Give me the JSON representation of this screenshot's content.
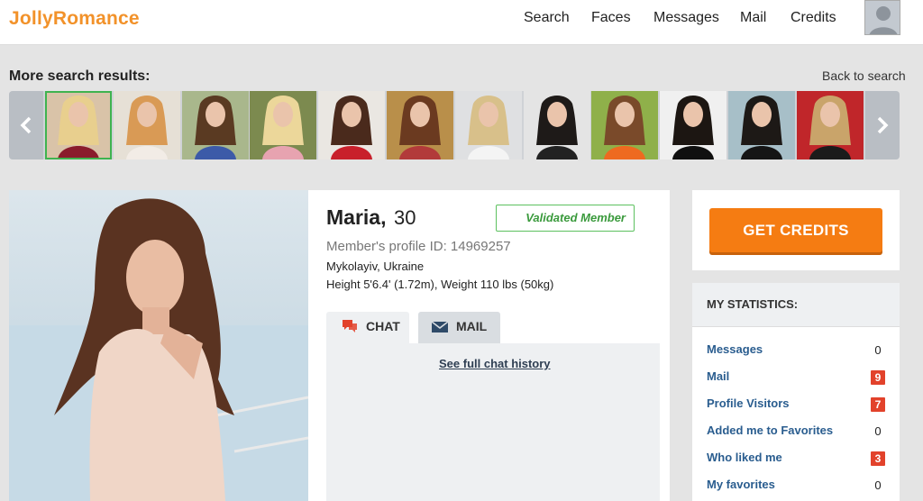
{
  "header": {
    "logo": "JollyRomance",
    "nav": [
      "Search",
      "Faces",
      "Messages",
      "Mail",
      "Credits"
    ]
  },
  "search_results": {
    "title": "More search results:",
    "back_label": "Back to search",
    "thumbnails": [
      {
        "bg": "#d9c3a8",
        "hair": "#e8cf8e",
        "cloth": "#8a1c2c"
      },
      {
        "bg": "#e6e0d6",
        "hair": "#d99a55",
        "cloth": "#f2ece6"
      },
      {
        "bg": "#a9b78c",
        "hair": "#5a3a22",
        "cloth": "#3c5aa8"
      },
      {
        "bg": "#7c8a4f",
        "hair": "#ecd79a",
        "cloth": "#e7a3b0"
      },
      {
        "bg": "#eae7e2",
        "hair": "#4a2a1c",
        "cloth": "#c8202b"
      },
      {
        "bg": "#b98f4a",
        "hair": "#6b3a20",
        "cloth": "#b23a3a"
      },
      {
        "bg": "#dfe0e2",
        "hair": "#d8c08a",
        "cloth": "#f4f4f4"
      },
      {
        "bg": "#e4e4e4",
        "hair": "#1e1a18",
        "cloth": "#222222"
      },
      {
        "bg": "#8fb04a",
        "hair": "#7a4a2a",
        "cloth": "#ee6a20"
      },
      {
        "bg": "#f0f0f0",
        "hair": "#1c1612",
        "cloth": "#101010"
      },
      {
        "bg": "#a7bfc8",
        "hair": "#1d1916",
        "cloth": "#151515"
      },
      {
        "bg": "#c0262a",
        "hair": "#c9a46a",
        "cloth": "#1b1b1b"
      }
    ]
  },
  "profile": {
    "name": "Maria,",
    "age": "30",
    "validated": "Validated Member",
    "member_id": "Member's profile ID: 14969257",
    "location": "Mykolayiv, Ukraine",
    "height": "Height 5'6.4' (1.72m), Weight 110 lbs (50kg)",
    "tabs": {
      "chat": "CHAT",
      "mail": "MAIL"
    },
    "history_link": "See full chat history"
  },
  "sidebar": {
    "credits_button": "GET CREDITS",
    "stats_title": "MY STATISTICS:",
    "stats": [
      {
        "label": "Messages",
        "value": "0",
        "badge": false
      },
      {
        "label": "Mail",
        "value": "9",
        "badge": true
      },
      {
        "label": "Profile Visitors",
        "value": "7",
        "badge": true
      },
      {
        "label": "Added me to Favorites",
        "value": "0",
        "badge": false
      },
      {
        "label": "Who liked me",
        "value": "3",
        "badge": true
      },
      {
        "label": "My favorites",
        "value": "0",
        "badge": false
      }
    ]
  },
  "colors": {
    "brand_orange": "#f57c12",
    "validated_green": "#3a9a3c",
    "link_blue": "#2a5d8f",
    "badge_red": "#e2422b"
  }
}
